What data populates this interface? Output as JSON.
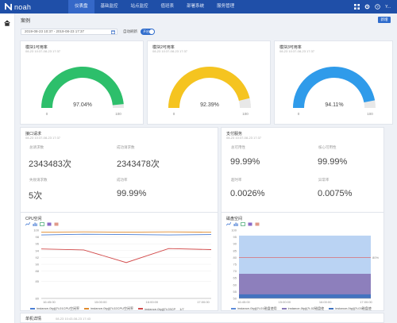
{
  "app": {
    "logo_text": "noah"
  },
  "nav": [
    {
      "label": "仪表盘",
      "active": true
    },
    {
      "label": "基础监控",
      "active": false
    },
    {
      "label": "站点监控",
      "active": false
    },
    {
      "label": "值班表",
      "active": false
    },
    {
      "label": "部署系统",
      "active": false
    },
    {
      "label": "服务管理",
      "active": false
    }
  ],
  "user": {
    "name": "Y..."
  },
  "page": {
    "title": "案例",
    "new_button": "新增"
  },
  "filters": {
    "date_range": "2019-08-23 10:37 - 2019-08-23 17:37",
    "auto_refresh_label": "自动刷新",
    "auto_refresh_state": "开启"
  },
  "gauges": [
    {
      "title": "模块1可用率",
      "subtitle": "08-23 10:37-08-23 17:37",
      "value_label": "97.04%",
      "value": 97.04,
      "min_label": "0",
      "max_label": "100",
      "color": "#2dbf6b"
    },
    {
      "title": "模块2可用率",
      "subtitle": "08-23 10:37-08-23 17:37",
      "value_label": "92.39%",
      "value": 92.39,
      "min_label": "0",
      "max_label": "100",
      "color": "#f5c420"
    },
    {
      "title": "模块3可用率",
      "subtitle": "08-23 10:37-08-23 17:37",
      "value_label": "94.11%",
      "value": 94.11,
      "min_label": "0",
      "max_label": "100",
      "color": "#2f9bea"
    }
  ],
  "api_panel": {
    "title": "接口请求",
    "subtitle": "08-23 10:37-08-23 17:37",
    "metrics": [
      {
        "label": "总请求数",
        "value": "2343483次"
      },
      {
        "label": "成功请求数",
        "value": "2343478次"
      },
      {
        "label": "失败请求数",
        "value": "5次"
      },
      {
        "label": "成功率",
        "value": "99.99%"
      }
    ]
  },
  "pay_panel": {
    "title": "支付服务",
    "subtitle": "08-23 10:37-08-23 17:37",
    "metrics": [
      {
        "label": "总可用性",
        "value": "99.99%"
      },
      {
        "label": "核心可用性",
        "value": "99.99%"
      },
      {
        "label": "超时率",
        "value": "0.0026%"
      },
      {
        "label": "异常率",
        "value": "0.0075%"
      }
    ]
  },
  "cpu_chart": {
    "title": "CPU空闲",
    "legend": [
      "instance-0tpjlj7t-01CPU空闲率",
      "instance-0tpjlj7t-02CPU空闲率",
      "instance-0tpjlj7t-03CP"
    ],
    "legend_colors": [
      "#4a7ed4",
      "#e08a2c",
      "#d24a4a"
    ],
    "pager": "1/7"
  },
  "disk_chart": {
    "title": "磁盘空间",
    "legend": [
      "instance-0tpjlj7t-01磁盘使用",
      "instance-0tpjlj7t-02磁盘使",
      "instance-0tpjlj7t-03磁盘使"
    ],
    "legend_colors": [
      "#5b8ad8",
      "#8a7ab8",
      "#3f73c0"
    ],
    "threshold_label": "80%"
  },
  "chart_data": [
    {
      "type": "line",
      "title": "CPU空闲",
      "x": [
        "16:45:00",
        "15:00:00",
        "16:00:00",
        "17:00:00"
      ],
      "ylim": [
        80,
        100
      ],
      "yticks": [
        80,
        85,
        88,
        90,
        92,
        94,
        96,
        98,
        100
      ],
      "series": [
        {
          "name": "instance-0tpjlj7t-01CPU空闲率",
          "values": [
            98.6,
            98.8,
            98.7,
            98.6,
            98.7
          ]
        },
        {
          "name": "instance-0tpjlj7t-02CPU空闲率",
          "values": [
            99.4,
            99.5,
            99.4,
            99.5,
            99.4
          ]
        },
        {
          "name": "instance-0tpjlj7t-03CP",
          "values": [
            94.5,
            94.2,
            90.5,
            94.6,
            94.3
          ]
        }
      ]
    },
    {
      "type": "area",
      "title": "磁盘空间",
      "x": [
        "16:45:00",
        "15:00:00",
        "16:00:00",
        "17:00:00"
      ],
      "ylim": [
        50,
        100
      ],
      "yticks": [
        50,
        55,
        60,
        65,
        70,
        75,
        80,
        85,
        90,
        95,
        100
      ],
      "series": [
        {
          "name": "instance-0tpjlj7t-01磁盘使用",
          "values": [
            96,
            96,
            96,
            96,
            96
          ]
        },
        {
          "name": "instance-0tpjlj7t-02磁盘使",
          "values": [
            68,
            68,
            68,
            68,
            68
          ]
        },
        {
          "name": "instance-0tpjlj7t-03磁盘使",
          "values": [
            53,
            53,
            53,
            53,
            53
          ]
        }
      ]
    }
  ],
  "bottom_panel": {
    "title": "单机详情",
    "subtitle": "08-23 10:43-08-23 17:43"
  }
}
